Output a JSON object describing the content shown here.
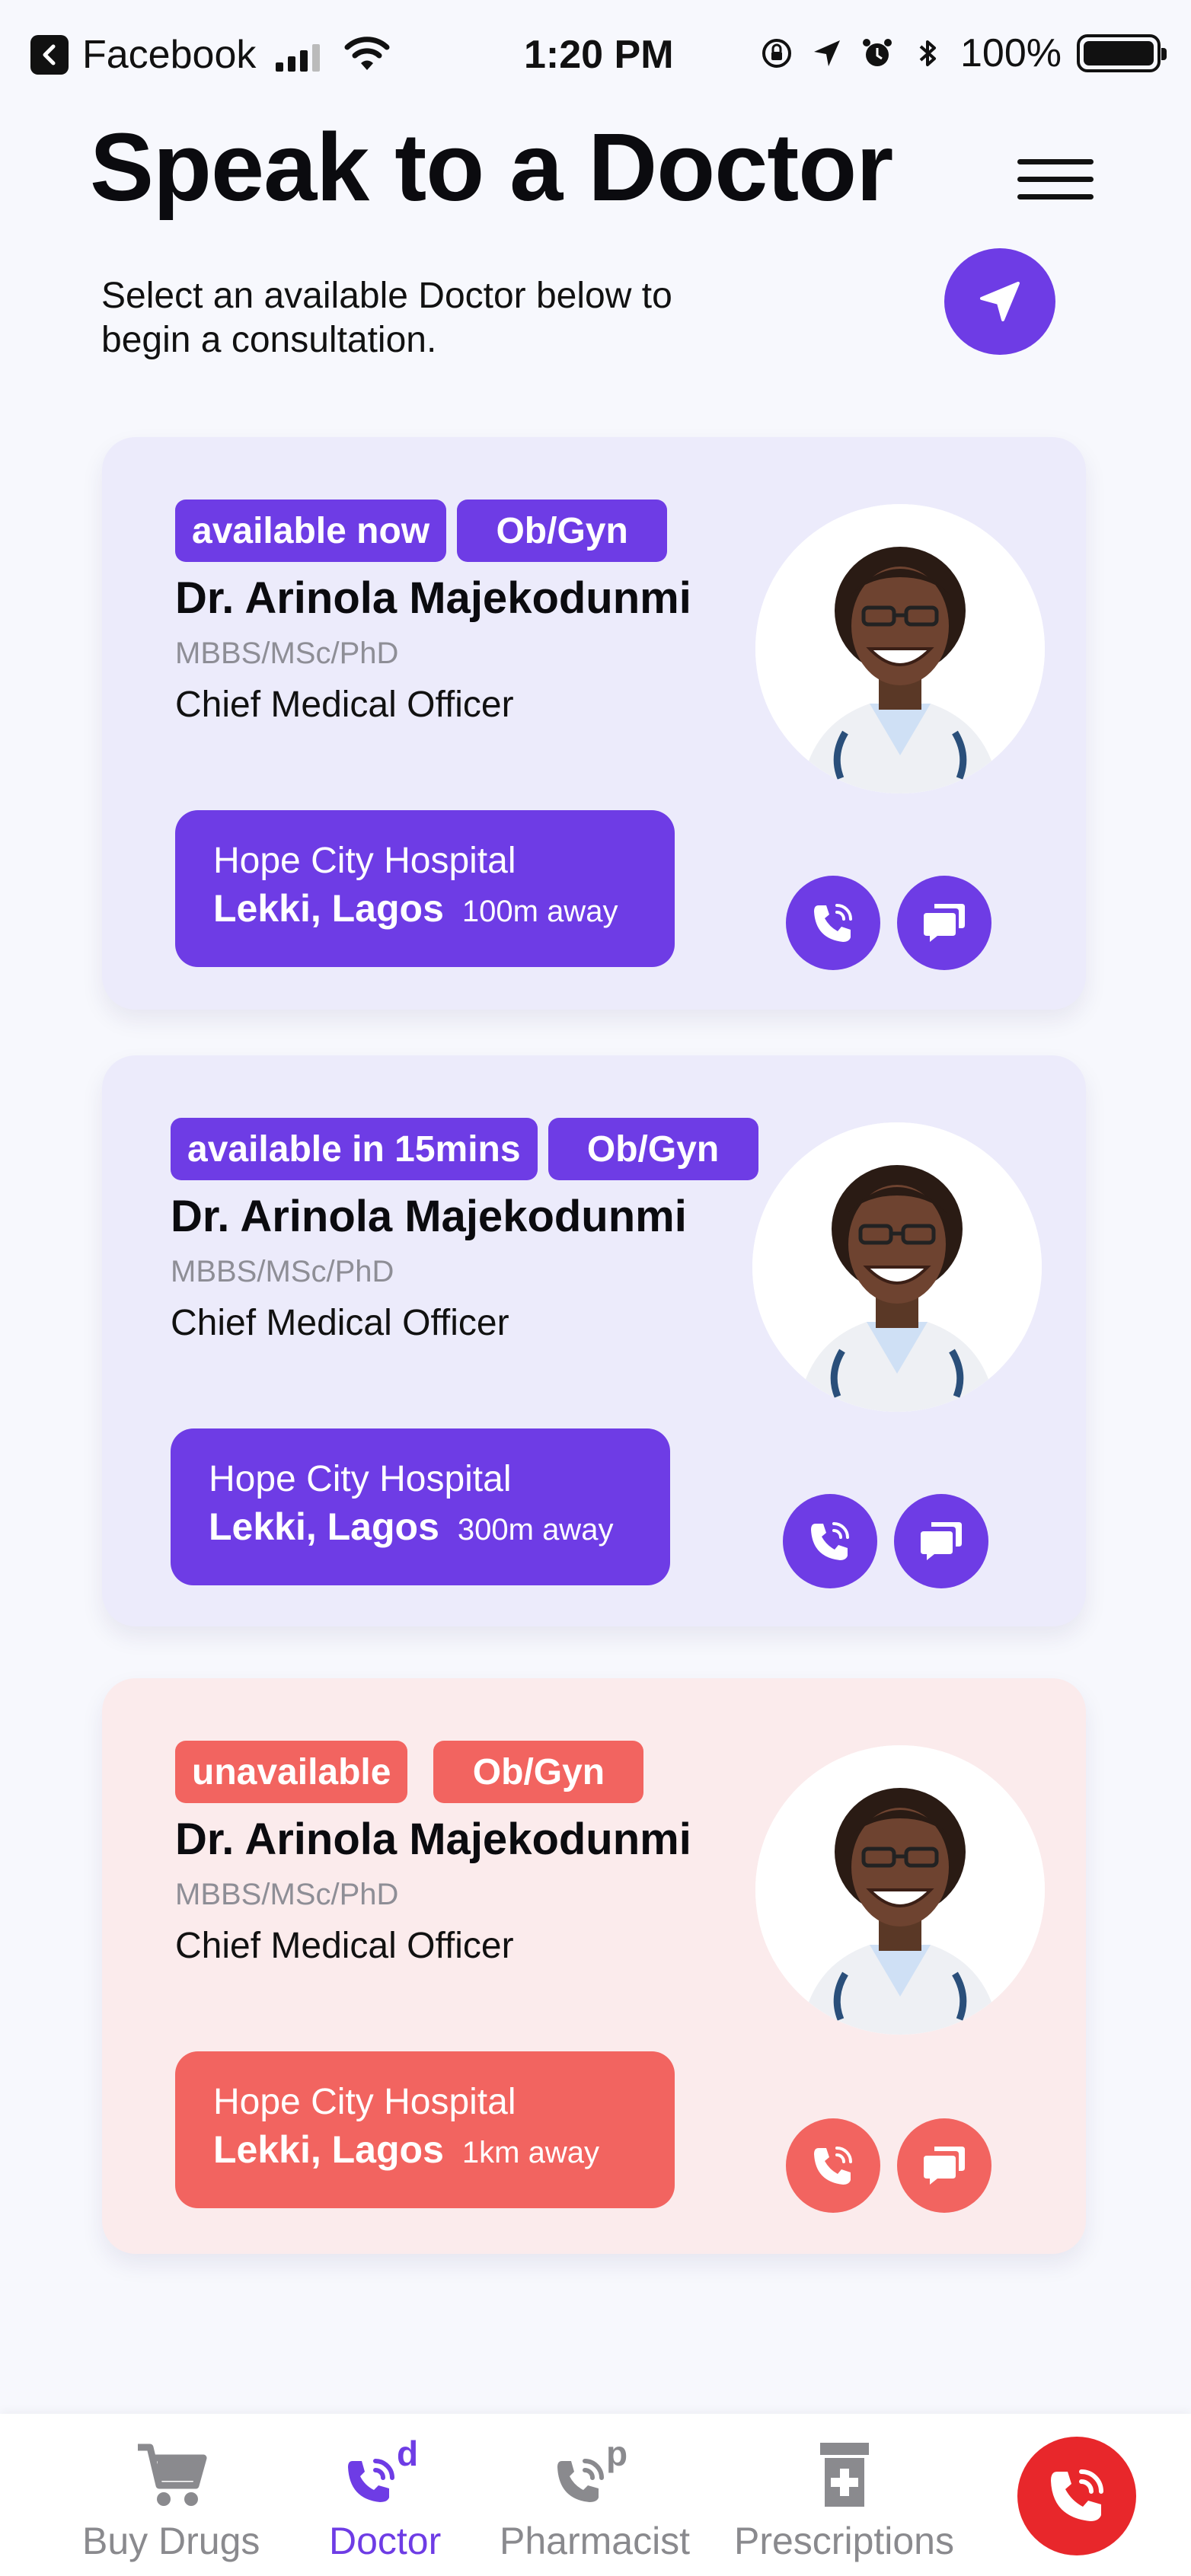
{
  "status_bar": {
    "back_app": "Facebook",
    "time": "1:20 PM",
    "battery": "100%"
  },
  "header": {
    "title": "Speak to a Doctor",
    "subtitle": "Select an available Doctor below to\nbegin a consultation."
  },
  "colors": {
    "accent": "#6e3ce5",
    "unavailable": "#f26460",
    "card_available_bg": "#ecebfb",
    "card_unavailable_bg": "#fbebec",
    "emergency": "#e8272b"
  },
  "doctors": [
    {
      "availability": "available now",
      "specialty": "Ob/Gyn",
      "name": "Dr. Arinola Majekodunmi",
      "qualifications": "MBBS/MSc/PhD",
      "role": "Chief Medical Officer",
      "hospital": "Hope City Hospital",
      "location": "Lekki, Lagos",
      "distance": "100m away",
      "call_icon": "phone-call-icon",
      "chat_icon": "chat-icon"
    },
    {
      "availability": "available in 15mins",
      "specialty": "Ob/Gyn",
      "name": "Dr. Arinola Majekodunmi",
      "qualifications": "MBBS/MSc/PhD",
      "role": "Chief Medical Officer",
      "hospital": "Hope City Hospital",
      "location": "Lekki, Lagos",
      "distance": "300m away",
      "call_icon": "phone-call-icon",
      "chat_icon": "chat-icon"
    },
    {
      "availability": "unavailable",
      "specialty": "Ob/Gyn",
      "name": "Dr. Arinola Majekodunmi",
      "qualifications": "MBBS/MSc/PhD",
      "role": "Chief Medical Officer",
      "hospital": "Hope City Hospital",
      "location": "Lekki, Lagos",
      "distance": "1km away",
      "call_icon": "phone-call-icon",
      "chat_icon": "chat-icon"
    }
  ],
  "bottom_nav": {
    "items": [
      {
        "label": "Buy Drugs",
        "icon": "cart-icon",
        "active": false
      },
      {
        "label": "Doctor",
        "icon": "doctor-call-icon",
        "active": true
      },
      {
        "label": "Pharmacist",
        "icon": "pharmacist-call-icon",
        "active": false
      },
      {
        "label": "Prescriptions",
        "icon": "prescription-bottle-icon",
        "active": false
      }
    ],
    "emergency_icon": "emergency-call-icon"
  }
}
